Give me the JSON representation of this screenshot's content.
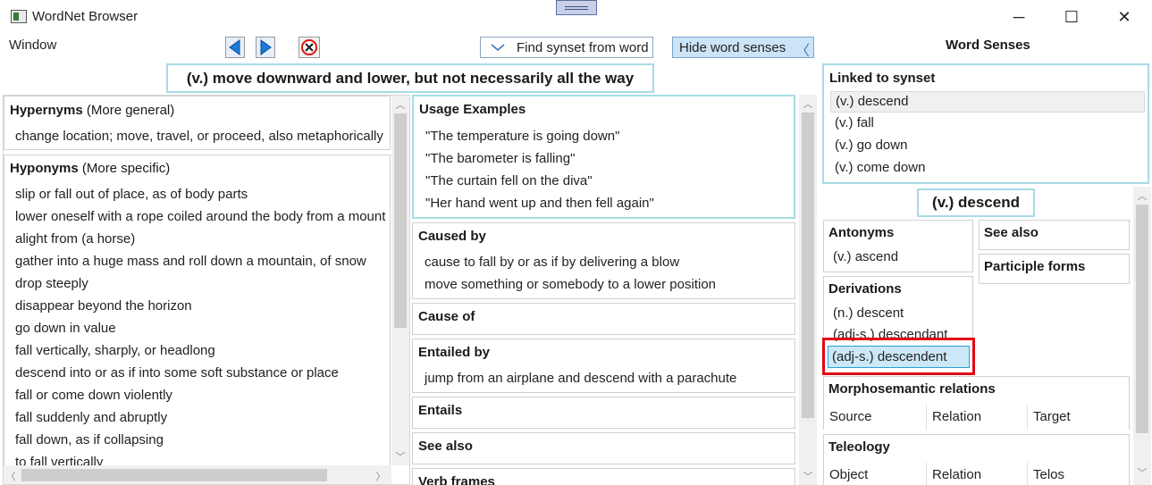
{
  "window": {
    "title": "WordNet Browser",
    "menu_window": "Window",
    "controls": {
      "minimize": "─",
      "maximize": "☐",
      "close": "✕"
    }
  },
  "toolbar": {
    "find_label": "Find synset from word",
    "hide_label": "Hide word senses",
    "hide_chevron": "〈",
    "find_chevron": "﹀"
  },
  "synset_title": "(v.) move downward and lower, but not necessarily all the way",
  "left": {
    "hypernyms": {
      "title": "Hypernyms",
      "subtitle": "(More general)",
      "items": [
        "change location; move, travel, or proceed, also metaphorically"
      ]
    },
    "hyponyms": {
      "title": "Hyponyms",
      "subtitle": "(More specific)",
      "items": [
        "slip or fall out of place, as of body parts",
        "lower oneself with a rope coiled around the body from a mount",
        "alight from (a horse)",
        "gather into a huge mass and roll down a mountain, of snow",
        "drop steeply",
        "disappear beyond the horizon",
        "go down in value",
        "fall vertically, sharply, or headlong",
        "descend into or as if into some soft substance or place",
        "fall or come down violently",
        "fall suddenly and abruptly",
        "fall down, as if collapsing",
        "to fall vertically"
      ]
    }
  },
  "middle": {
    "usage": {
      "title": "Usage Examples",
      "items": [
        "\"The temperature is going down\"",
        "\"The barometer is falling\"",
        "\"The curtain fell on the diva\"",
        "\"Her hand went up and then fell again\""
      ]
    },
    "caused_by": {
      "title": "Caused by",
      "items": [
        "cause to fall by or as if by delivering a blow",
        "move something or somebody to a lower position"
      ]
    },
    "cause_of": {
      "title": "Cause of"
    },
    "entailed_by": {
      "title": "Entailed by",
      "items": [
        "jump from an airplane and descend with a parachute"
      ]
    },
    "entails": {
      "title": "Entails"
    },
    "see_also": {
      "title": "See also"
    },
    "verb_frames": {
      "title": "Verb frames"
    }
  },
  "senses": {
    "title": "Word Senses",
    "linked_title": "Linked to synset",
    "linked_items": [
      "(v.) descend",
      "(v.) fall",
      "(v.) go down",
      "(v.) come down"
    ],
    "selected_sense": "(v.) descend",
    "antonyms": {
      "title": "Antonyms",
      "items": [
        "(v.) ascend"
      ]
    },
    "see_also": {
      "title": "See also"
    },
    "participle_forms": {
      "title": "Participle forms"
    },
    "derivations": {
      "title": "Derivations",
      "items": [
        "(n.) descent",
        "(adj-s.) descendant",
        "(adj-s.) descendent"
      ]
    },
    "morphosemantic": {
      "title": "Morphosemantic relations",
      "columns": [
        "Source",
        "Relation",
        "Target"
      ]
    },
    "teleology": {
      "title": "Teleology",
      "columns": [
        "Object",
        "Relation",
        "Telos"
      ]
    }
  },
  "colors": {
    "accent_border": "#a8dbe6",
    "selection_fill": "#cce8f8",
    "highlight_red": "#e30613",
    "nav_blue": "#1c7ad8"
  }
}
